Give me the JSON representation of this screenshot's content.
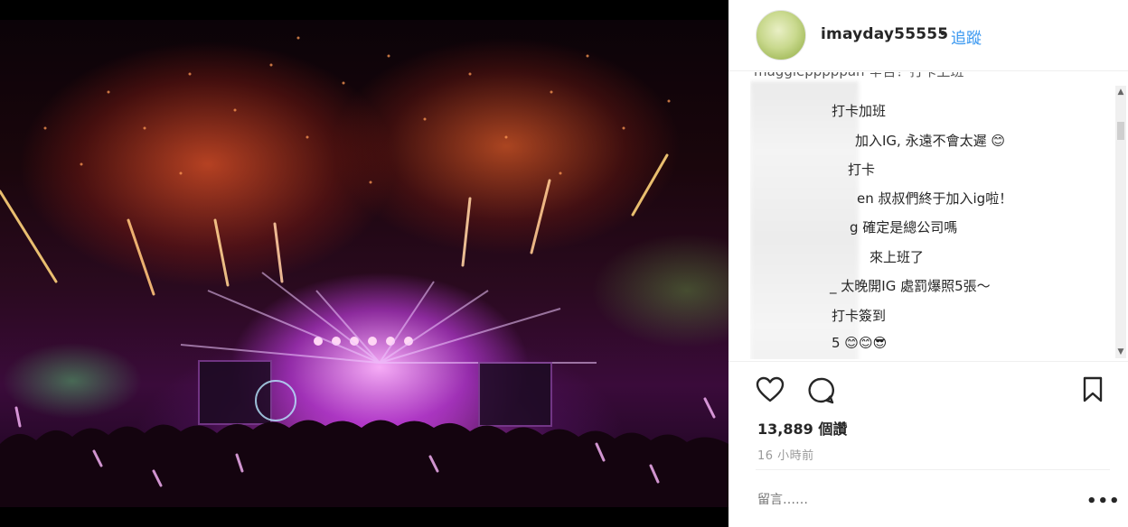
{
  "post": {
    "username": "imayday55555",
    "separator": "•",
    "follow_label": "追蹤",
    "photo_alt": "concert-fireworks"
  },
  "comments": {
    "top_cut": "maggiepppppan 辛苦！打卡上班",
    "items": [
      {
        "text": "打卡加班"
      },
      {
        "text": "加入IG, 永遠不會太遲 😊"
      },
      {
        "text": "打卡"
      },
      {
        "text": "en 叔叔們終于加入ig啦！"
      },
      {
        "text": "g 確定是總公司嗎"
      },
      {
        "text": "來上班了"
      },
      {
        "text": "_ 太晚開IG 處罰爆照5張～"
      },
      {
        "text": "打卡簽到"
      },
      {
        "text": "5 😊😊😎"
      }
    ]
  },
  "stats": {
    "likes": "13,889 個讚",
    "time": "16 小時前"
  },
  "comment_box": {
    "placeholder": "留言……",
    "more_label": "•••"
  },
  "icons": {
    "heart": "heart-icon",
    "comment": "comment-icon",
    "bookmark": "bookmark-icon"
  }
}
